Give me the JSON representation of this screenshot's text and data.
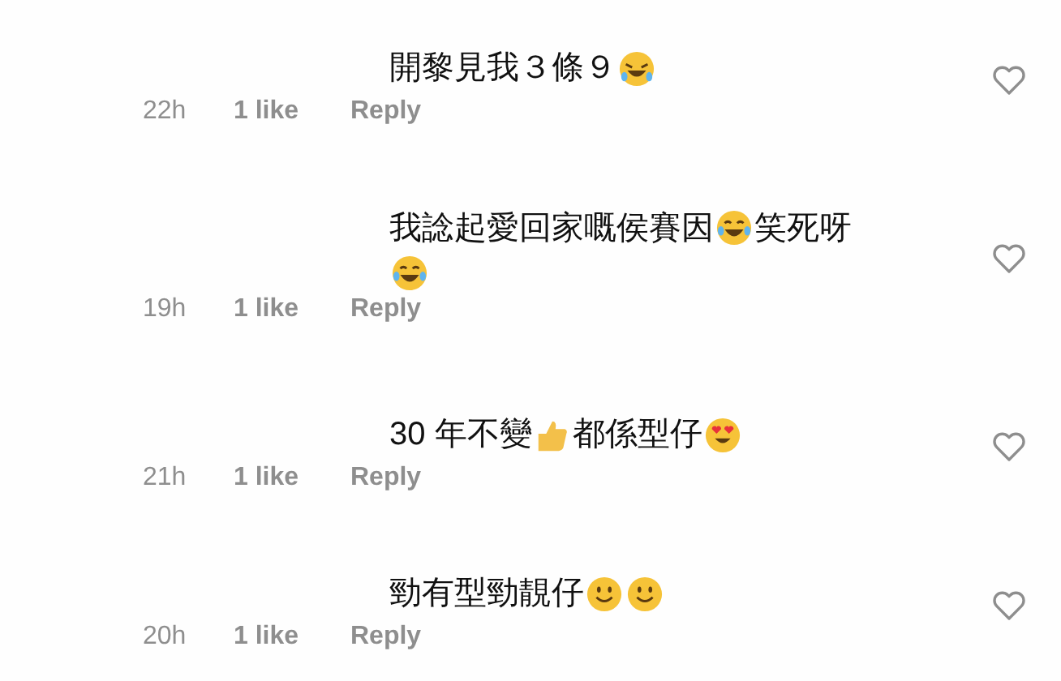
{
  "comments": [
    {
      "body": [
        {
          "kind": "text",
          "text": "開黎見我３條９"
        },
        {
          "kind": "rofl"
        }
      ],
      "time": "22h",
      "likes": "1 like",
      "reply": "Reply",
      "liked": false
    },
    {
      "body": [
        {
          "kind": "text",
          "text": "我諗起愛回家嘅侯賽因"
        },
        {
          "kind": "joy"
        },
        {
          "kind": "text",
          "text": "笑死呀"
        },
        {
          "kind": "joy"
        }
      ],
      "time": "19h",
      "likes": "1 like",
      "reply": "Reply",
      "liked": false
    },
    {
      "body": [
        {
          "kind": "text",
          "text": "30 年不變"
        },
        {
          "kind": "thumbs"
        },
        {
          "kind": "text",
          "text": "都係型仔"
        },
        {
          "kind": "heart-eyes"
        }
      ],
      "time": "21h",
      "likes": "1 like",
      "reply": "Reply",
      "liked": false
    },
    {
      "body": [
        {
          "kind": "text",
          "text": "勁有型勁靚仔"
        },
        {
          "kind": "smile"
        },
        {
          "kind": "smile"
        }
      ],
      "time": "20h",
      "likes": "1 like",
      "reply": "Reply",
      "liked": false
    }
  ]
}
